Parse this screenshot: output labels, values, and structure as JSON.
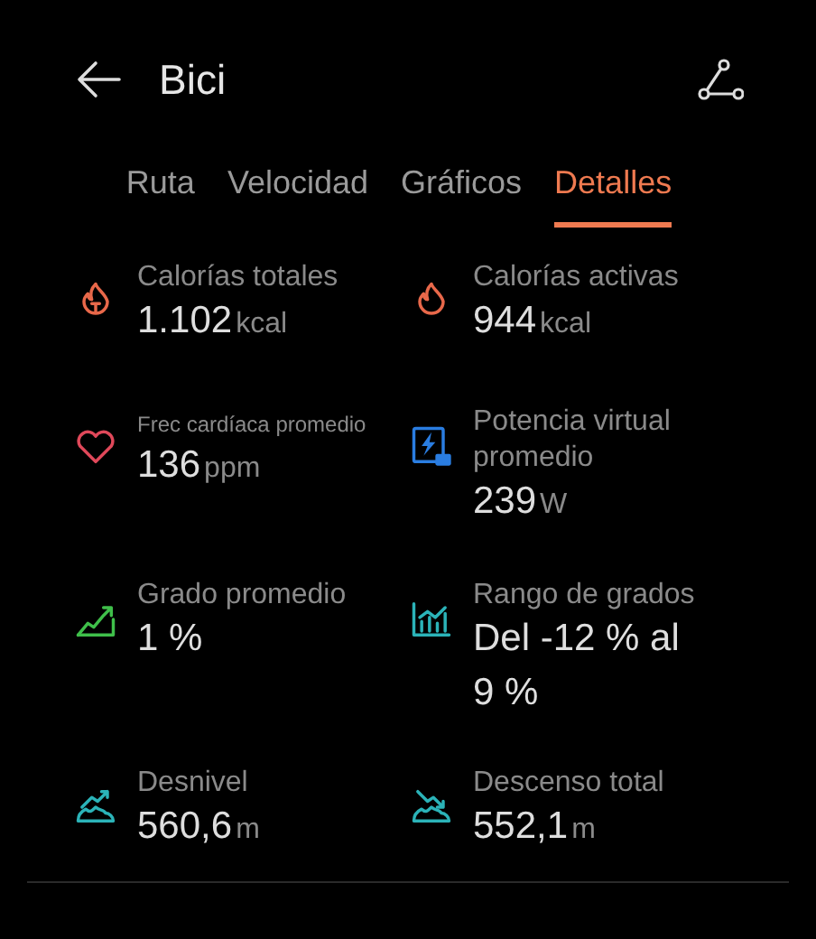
{
  "header": {
    "title": "Bici"
  },
  "tabs": [
    {
      "label": "Ruta",
      "selected": false
    },
    {
      "label": "Velocidad",
      "selected": false
    },
    {
      "label": "Gráficos",
      "selected": false
    },
    {
      "label": "Detalles",
      "selected": true
    }
  ],
  "metrics": [
    {
      "kind": "total-calories",
      "color": "#e8684a",
      "label": "Calorías totales",
      "compact": false,
      "value": "1.102",
      "unit": "kcal"
    },
    {
      "kind": "active-calories",
      "color": "#e8684a",
      "label": "Calorías activas",
      "compact": false,
      "value": "944",
      "unit": "kcal"
    },
    {
      "kind": "heart",
      "color": "#e0485a",
      "label": "Frec cardíaca promedio",
      "compact": true,
      "value": "136",
      "unit": "ppm"
    },
    {
      "kind": "power",
      "color": "#2a7de1",
      "label": "Potencia virtual promedio",
      "compact": false,
      "value": "239",
      "unit": "W"
    },
    {
      "kind": "grade",
      "color": "#3fbf4a",
      "label": "Grado promedio",
      "compact": false,
      "value": "1 %"
    },
    {
      "kind": "grade-range",
      "color": "#2bb3b8",
      "label": "Rango de grados",
      "compact": false,
      "value": "Del -12 % al 9 %"
    },
    {
      "kind": "ascent",
      "color": "#2bb3b8",
      "label": "Desnivel",
      "compact": false,
      "value": "560,6",
      "unit": "m"
    },
    {
      "kind": "descent",
      "color": "#2bb3b8",
      "label": "Descenso total",
      "compact": false,
      "value": "552,1",
      "unit": "m"
    }
  ]
}
